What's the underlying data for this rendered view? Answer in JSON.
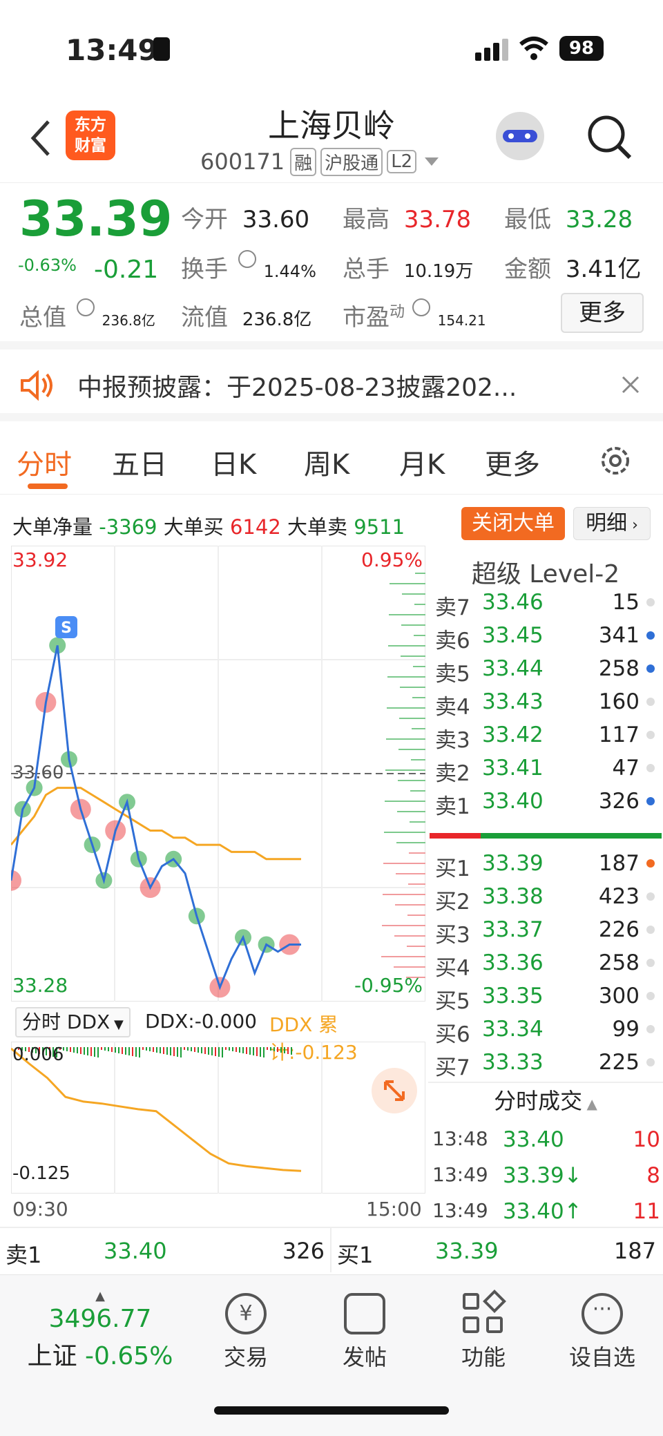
{
  "status_bar": {
    "time": "13:49",
    "battery": "98"
  },
  "header": {
    "title": "上海贝岭",
    "code": "600171",
    "tags": [
      "融",
      "沪股通",
      "L2"
    ],
    "logo_text": "东方财富"
  },
  "quote": {
    "price": "33.39",
    "change_pct": "-0.63%",
    "change": "-0.21",
    "open_label": "今开",
    "open": "33.60",
    "high_label": "最高",
    "high": "33.78",
    "low_label": "最低",
    "low": "33.28",
    "turnover_label": "换手",
    "turnover": "1.44%",
    "volume_label": "总手",
    "volume": "10.19万",
    "amount_label": "金额",
    "amount": "3.41亿",
    "mktcap_label": "总值",
    "mktcap": "236.8亿",
    "float_label": "流值",
    "float_cap": "236.8亿",
    "pe_label": "市盈",
    "pe_sup": "动",
    "pe": "154.21",
    "more_btn": "更多"
  },
  "notice": {
    "text": "中报预披露：于2025-08-23披露202..."
  },
  "tabs": [
    "分时",
    "五日",
    "日K",
    "周K",
    "月K",
    "更多"
  ],
  "big_order": {
    "net_label": "大单净量",
    "net": "-3369",
    "buy_label": "大单买",
    "buy": "6142",
    "sell_label": "大单卖",
    "sell": "9511",
    "close_btn": "关闭大单",
    "detail_btn": "明细"
  },
  "chart_data": {
    "type": "line",
    "series": [
      {
        "values": [
          33.45,
          33.55,
          33.58,
          33.7,
          33.78,
          33.62,
          33.55,
          33.5,
          33.45,
          33.52,
          33.56,
          33.48,
          33.44,
          33.47,
          33.48,
          33.46,
          33.4,
          33.35,
          33.3,
          33.34,
          33.37,
          33.32,
          33.36,
          33.35,
          33.36,
          33.36
        ]
      },
      {
        "values": [
          33.5,
          33.52,
          33.54,
          33.57,
          33.58,
          33.58,
          33.58,
          33.57,
          33.56,
          33.55,
          33.54,
          33.53,
          33.52,
          33.52,
          33.51,
          33.51,
          33.5,
          33.5,
          33.5,
          33.49,
          33.49,
          33.49,
          33.48,
          33.48,
          33.48,
          33.48
        ]
      }
    ],
    "ylim": [
      33.28,
      33.92
    ],
    "top_left": "33.92",
    "bottom_left": "33.28",
    "top_right": "0.95%",
    "bottom_right": "-0.95%",
    "ref_label": "33.60",
    "x_start": "09:30",
    "x_end": "15:00"
  },
  "ddx": {
    "selector": "分时 DDX",
    "value_label": "DDX:-0.000",
    "cum_label": "DDX 累计:-0.123",
    "top_val": "0.006",
    "bottom_val": "-0.125",
    "cum_series": [
      0.006,
      -0.01,
      -0.025,
      -0.045,
      -0.05,
      -0.052,
      -0.055,
      -0.058,
      -0.06,
      -0.075,
      -0.09,
      -0.105,
      -0.115,
      -0.118,
      -0.12,
      -0.122,
      -0.123
    ]
  },
  "level2": {
    "title": "超级 Level-2",
    "asks": [
      {
        "label": "卖7",
        "price": "33.46",
        "vol": "15",
        "dot": "#dddddd"
      },
      {
        "label": "卖6",
        "price": "33.45",
        "vol": "341",
        "dot": "#2f6fd6"
      },
      {
        "label": "卖5",
        "price": "33.44",
        "vol": "258",
        "dot": "#2f6fd6"
      },
      {
        "label": "卖4",
        "price": "33.43",
        "vol": "160",
        "dot": "#dddddd"
      },
      {
        "label": "卖3",
        "price": "33.42",
        "vol": "117",
        "dot": "#dddddd"
      },
      {
        "label": "卖2",
        "price": "33.41",
        "vol": "47",
        "dot": "#dddddd"
      },
      {
        "label": "卖1",
        "price": "33.40",
        "vol": "326",
        "dot": "#2f6fd6"
      }
    ],
    "bids": [
      {
        "label": "买1",
        "price": "33.39",
        "vol": "187",
        "dot": "#f26a21"
      },
      {
        "label": "买2",
        "price": "33.38",
        "vol": "423",
        "dot": "#dddddd"
      },
      {
        "label": "买3",
        "price": "33.37",
        "vol": "226",
        "dot": "#dddddd"
      },
      {
        "label": "买4",
        "price": "33.36",
        "vol": "258",
        "dot": "#dddddd"
      },
      {
        "label": "买5",
        "price": "33.35",
        "vol": "300",
        "dot": "#dddddd"
      },
      {
        "label": "买6",
        "price": "33.34",
        "vol": "99",
        "dot": "#dddddd"
      },
      {
        "label": "买7",
        "price": "33.33",
        "vol": "225",
        "dot": "#dddddd"
      }
    ],
    "ticks_title": "分时成交",
    "ticks": [
      {
        "time": "13:48",
        "price": "33.40",
        "vol": "10",
        "arrow": ""
      },
      {
        "time": "13:49",
        "price": "33.39",
        "vol": "8",
        "arrow": "↓"
      },
      {
        "time": "13:49",
        "price": "33.40",
        "vol": "11",
        "arrow": "↑"
      }
    ]
  },
  "bottom_quote": {
    "sell_label": "卖1",
    "sell_price": "33.40",
    "sell_vol": "326",
    "buy_label": "买1",
    "buy_price": "33.39",
    "buy_vol": "187"
  },
  "bottom_nav": {
    "index_value": "3496.77",
    "index_name": "上证",
    "index_change": "-0.65%",
    "items": [
      "交易",
      "发帖",
      "功能",
      "设自选"
    ]
  }
}
